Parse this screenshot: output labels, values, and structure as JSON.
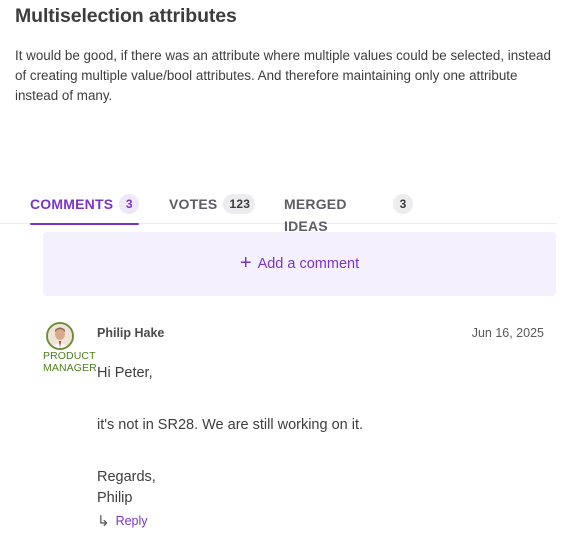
{
  "idea": {
    "title": "Multiselection attributes",
    "description": "It would be good, if there was an attribute where multiple values could be selected, instead of creating multiple value/bool attributes. And therefore maintaining only one attribute instead of many."
  },
  "tabs": [
    {
      "label": "COMMENTS",
      "count": "3",
      "active": true
    },
    {
      "label": "VOTES",
      "count": "123",
      "active": false
    },
    {
      "label": "MERGED IDEAS",
      "count": "3",
      "active": false
    }
  ],
  "add_comment": {
    "icon": "+",
    "label": "Add a comment"
  },
  "comment": {
    "author": "Philip Hake",
    "role_line1": "PRODUCT",
    "role_line2": "MANAGER",
    "date": "Jun 16, 2025",
    "body": {
      "greeting": "Hi Peter,",
      "message": "it's not in SR28. We are still working on it.",
      "closing": "Regards,",
      "signature": "Philip"
    },
    "reply_icon": "↳",
    "reply_label": "Reply"
  },
  "colors": {
    "accent": "#7a35c8",
    "accent_bg": "#f4f0fd",
    "role": "#4f7d1e",
    "text": "#3d3d3d"
  }
}
